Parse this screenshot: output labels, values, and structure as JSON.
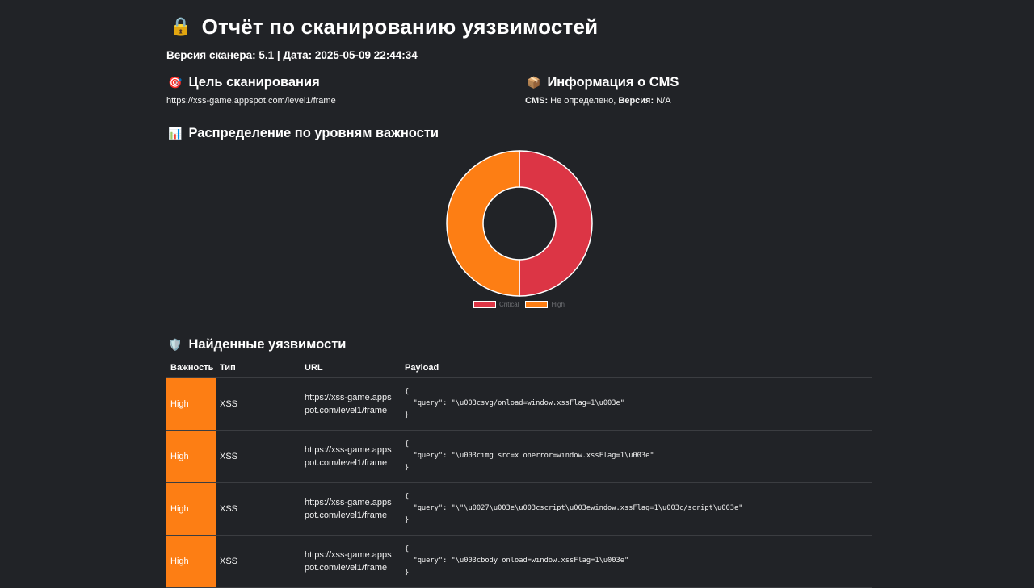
{
  "header": {
    "title_icon": "lock-icon",
    "title": "Отчёт по сканированию уязвимостей",
    "meta": "Версия сканера: 5.1 | Дата: 2025-05-09 22:44:34"
  },
  "target": {
    "icon": "target-icon",
    "heading": "Цель сканирования",
    "url": "https://xss-game.appspot.com/level1/frame"
  },
  "cms": {
    "icon": "package-icon",
    "heading": "Информация о CMS",
    "cms_label": "CMS:",
    "cms_value": "Не определено,",
    "version_label": "Версия:",
    "version_value": "N/A"
  },
  "distribution": {
    "icon": "bar-chart-icon",
    "heading": "Распределение по уровням важности"
  },
  "chart_data": {
    "type": "pie",
    "variant": "doughnut",
    "title": "",
    "categories": [
      "Critical",
      "High"
    ],
    "values": [
      50,
      50
    ],
    "colors": [
      "#dc3545",
      "#fd7e14"
    ],
    "legend_position": "bottom"
  },
  "vulnerabilities": {
    "icon": "shield-icon",
    "heading": "Найденные уязвимости",
    "columns": [
      "Важность",
      "Тип",
      "URL",
      "Payload"
    ],
    "severity_color": "#fd7e14",
    "rows": [
      {
        "severity": "High",
        "type": "XSS",
        "url": "https://xss-game.appspot.com/level1/frame",
        "payload": "{\n  \"query\": \"\\u003csvg/onload=window.xssFlag=1\\u003e\"\n}"
      },
      {
        "severity": "High",
        "type": "XSS",
        "url": "https://xss-game.appspot.com/level1/frame",
        "payload": "{\n  \"query\": \"\\u003cimg src=x onerror=window.xssFlag=1\\u003e\"\n}"
      },
      {
        "severity": "High",
        "type": "XSS",
        "url": "https://xss-game.appspot.com/level1/frame",
        "payload": "{\n  \"query\": \"\\\"\\u0027\\u003e\\u003cscript\\u003ewindow.xssFlag=1\\u003c/script\\u003e\"\n}"
      },
      {
        "severity": "High",
        "type": "XSS",
        "url": "https://xss-game.appspot.com/level1/frame",
        "payload": "{\n  \"query\": \"\\u003cbody onload=window.xssFlag=1\\u003e\"\n}"
      }
    ]
  }
}
